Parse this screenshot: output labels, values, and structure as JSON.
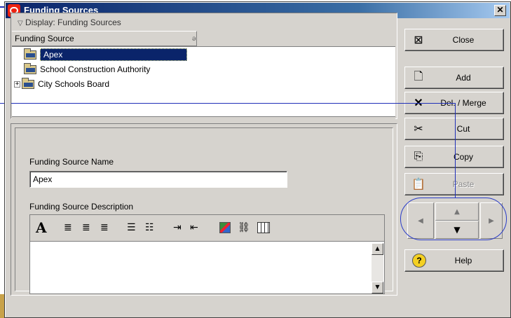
{
  "window": {
    "title": "Funding Sources",
    "close_glyph": "✕"
  },
  "list": {
    "display_header": "Display: Funding Sources",
    "column_header": "Funding Source",
    "rows": [
      {
        "label": "Apex",
        "selected": true,
        "expandable": false
      },
      {
        "label": "School Construction Authority",
        "selected": false,
        "expandable": false
      },
      {
        "label": "City Schools Board",
        "selected": false,
        "expandable": true
      }
    ]
  },
  "form": {
    "name_label": "Funding Source Name",
    "name_value": "Apex",
    "description_label": "Funding Source Description",
    "description_value": "",
    "toolbar_icons": [
      "font-icon",
      "align-left-icon",
      "align-center-icon",
      "align-right-icon",
      "bulleted-list-icon",
      "numbered-list-icon",
      "indent-icon",
      "outdent-icon",
      "insert-image-icon",
      "link-icon",
      "insert-table-icon"
    ]
  },
  "buttons": {
    "close": "Close",
    "add": "Add",
    "delete_merge": "Del. / Merge",
    "cut": "Cut",
    "copy": "Copy",
    "paste": "Paste",
    "help": "Help"
  },
  "nav_pad": {
    "up": "▲",
    "down": "▼",
    "left": "◀",
    "right": "▶"
  },
  "colors": {
    "selection": "#0a246a",
    "callout": "#1f2fb8",
    "title_gradient_start": "#0a246a"
  }
}
